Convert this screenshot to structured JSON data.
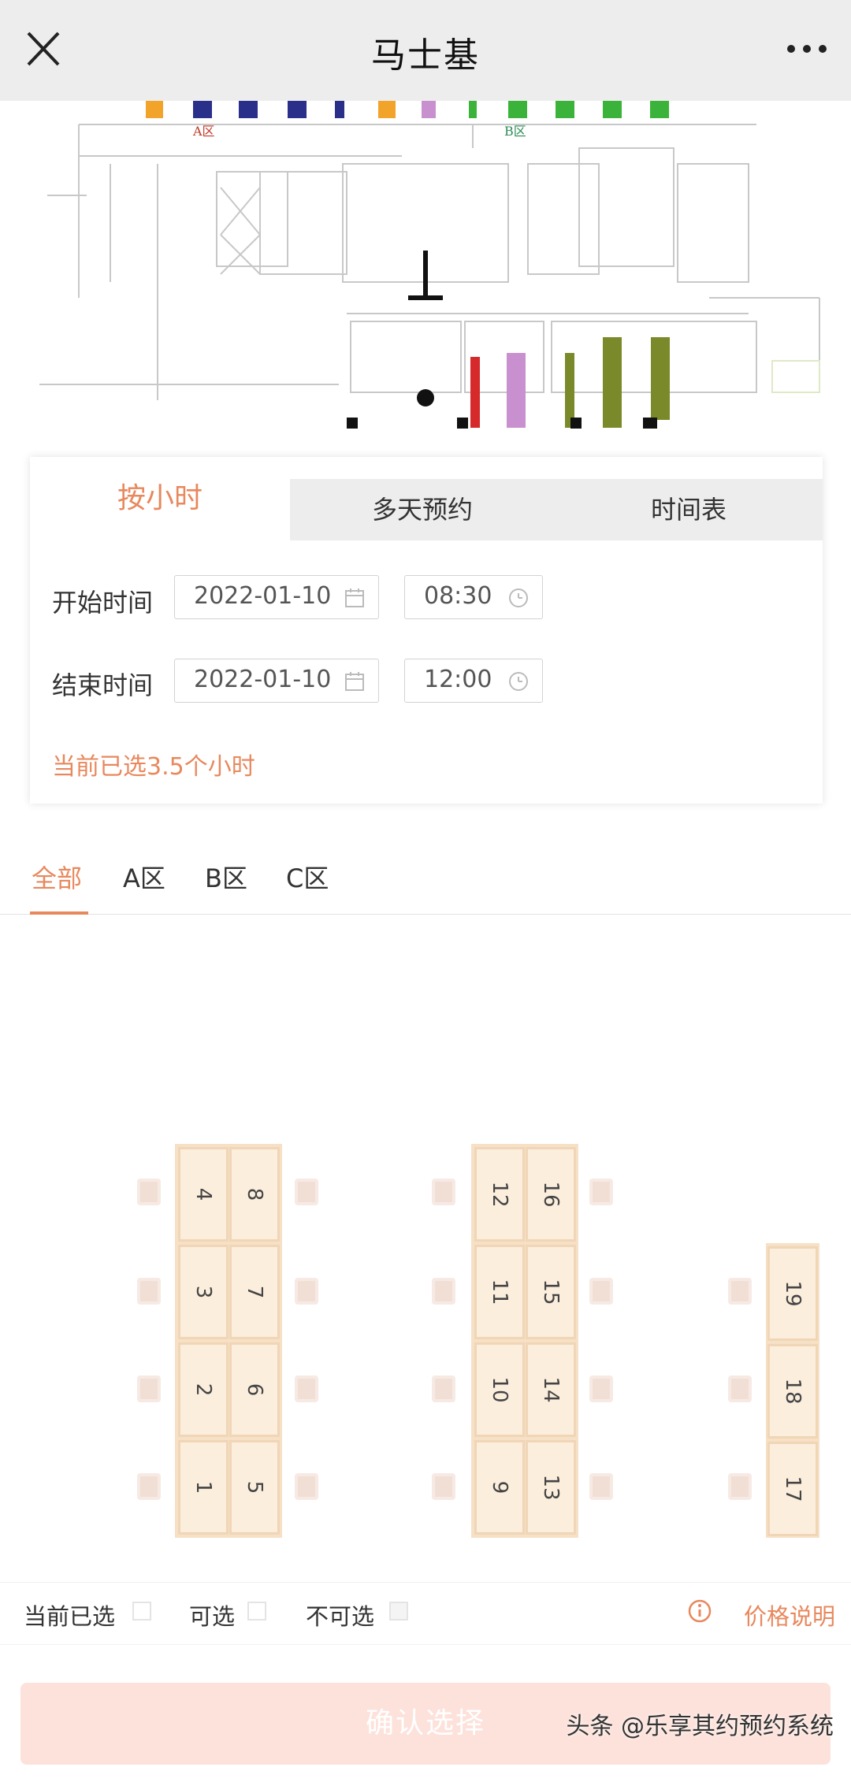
{
  "nav": {
    "title": "马士基"
  },
  "floorplan": {
    "zone_a": "A区",
    "zone_b": "B区"
  },
  "tabs": [
    {
      "label": "按小时",
      "active": true
    },
    {
      "label": "多天预约",
      "active": false
    },
    {
      "label": "时间表",
      "active": false
    }
  ],
  "start": {
    "label": "开始时间",
    "date": "2022-01-10",
    "time": "08:30"
  },
  "end": {
    "label": "结束时间",
    "date": "2022-01-10",
    "time": "12:00"
  },
  "selected_hint": "当前已选3.5个小时",
  "zones": [
    {
      "label": "全部",
      "active": true
    },
    {
      "label": "A区",
      "active": false
    },
    {
      "label": "B区",
      "active": false
    },
    {
      "label": "C区",
      "active": false
    }
  ],
  "seats": [
    "1",
    "2",
    "3",
    "4",
    "5",
    "6",
    "7",
    "8",
    "9",
    "10",
    "11",
    "12",
    "13",
    "14",
    "15",
    "16",
    "17",
    "18",
    "19"
  ],
  "legend": {
    "selected": "当前已选",
    "available": "可选",
    "unavailable": "不可选",
    "price": "价格说明"
  },
  "confirm_label": "确认选择",
  "watermark": "头条 @乐享其约预约系统",
  "colors": {
    "accent": "#e8885d",
    "desk": "#fbeedd",
    "confirm_bg": "#fde2db"
  }
}
